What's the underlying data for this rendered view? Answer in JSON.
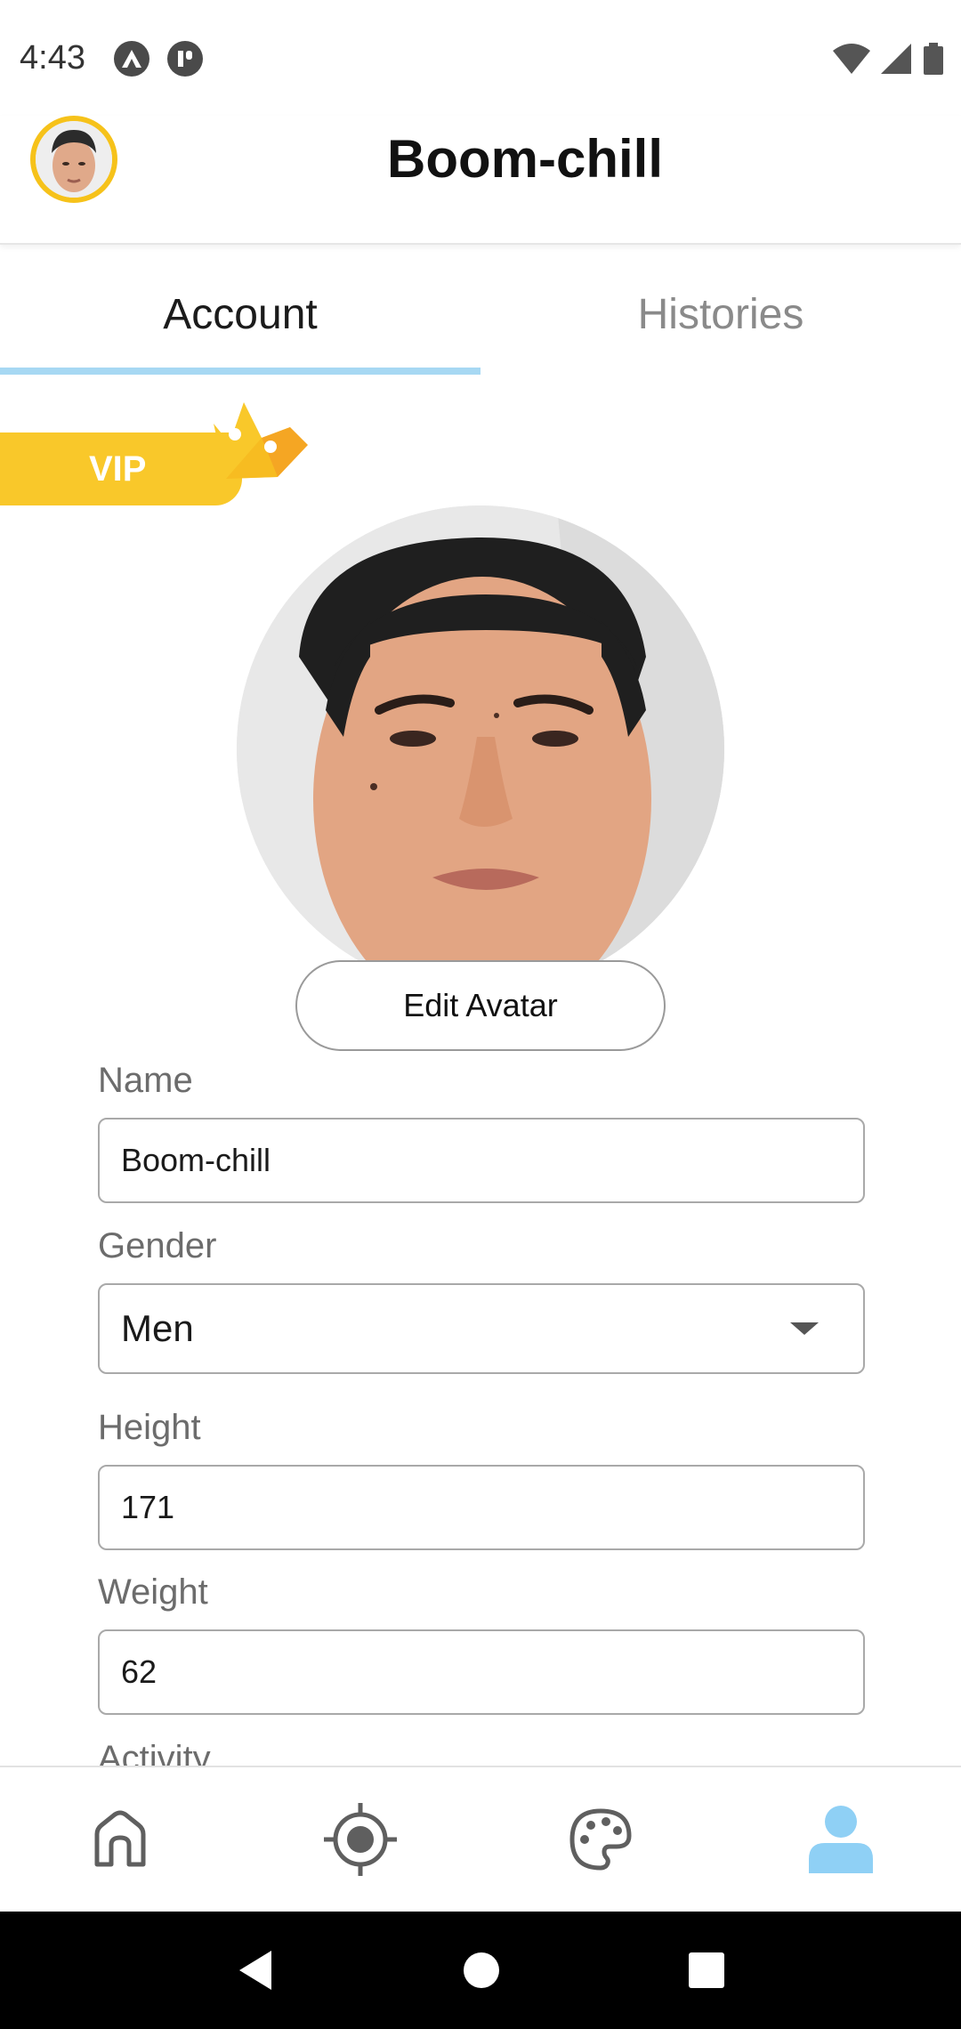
{
  "status_bar": {
    "time": "4:43",
    "icons": [
      "a-logo-icon",
      "pause-app-icon",
      "wifi-icon",
      "signal-icon",
      "battery-icon"
    ]
  },
  "header": {
    "title": "Boom-chill",
    "avatar_border_color": "#f6c21a"
  },
  "tabs": [
    {
      "label": "Account",
      "active": true
    },
    {
      "label": "Histories",
      "active": false
    }
  ],
  "vip": {
    "label": "VIP",
    "color": "#f9c82a"
  },
  "edit_avatar_label": "Edit Avatar",
  "form": {
    "name": {
      "label": "Name",
      "value": "Boom-chill"
    },
    "gender": {
      "label": "Gender",
      "value": "Men"
    },
    "height": {
      "label": "Height",
      "value": "171"
    },
    "weight": {
      "label": "Weight",
      "value": "62"
    },
    "activity": {
      "label": "Activity"
    }
  },
  "bottom_nav": [
    {
      "icon": "home-icon",
      "active": false
    },
    {
      "icon": "target-icon",
      "active": false
    },
    {
      "icon": "palette-icon",
      "active": false
    },
    {
      "icon": "profile-icon",
      "active": true
    }
  ],
  "colors": {
    "accent": "#a7d8f3",
    "active_nav": "#8fd0f5"
  }
}
